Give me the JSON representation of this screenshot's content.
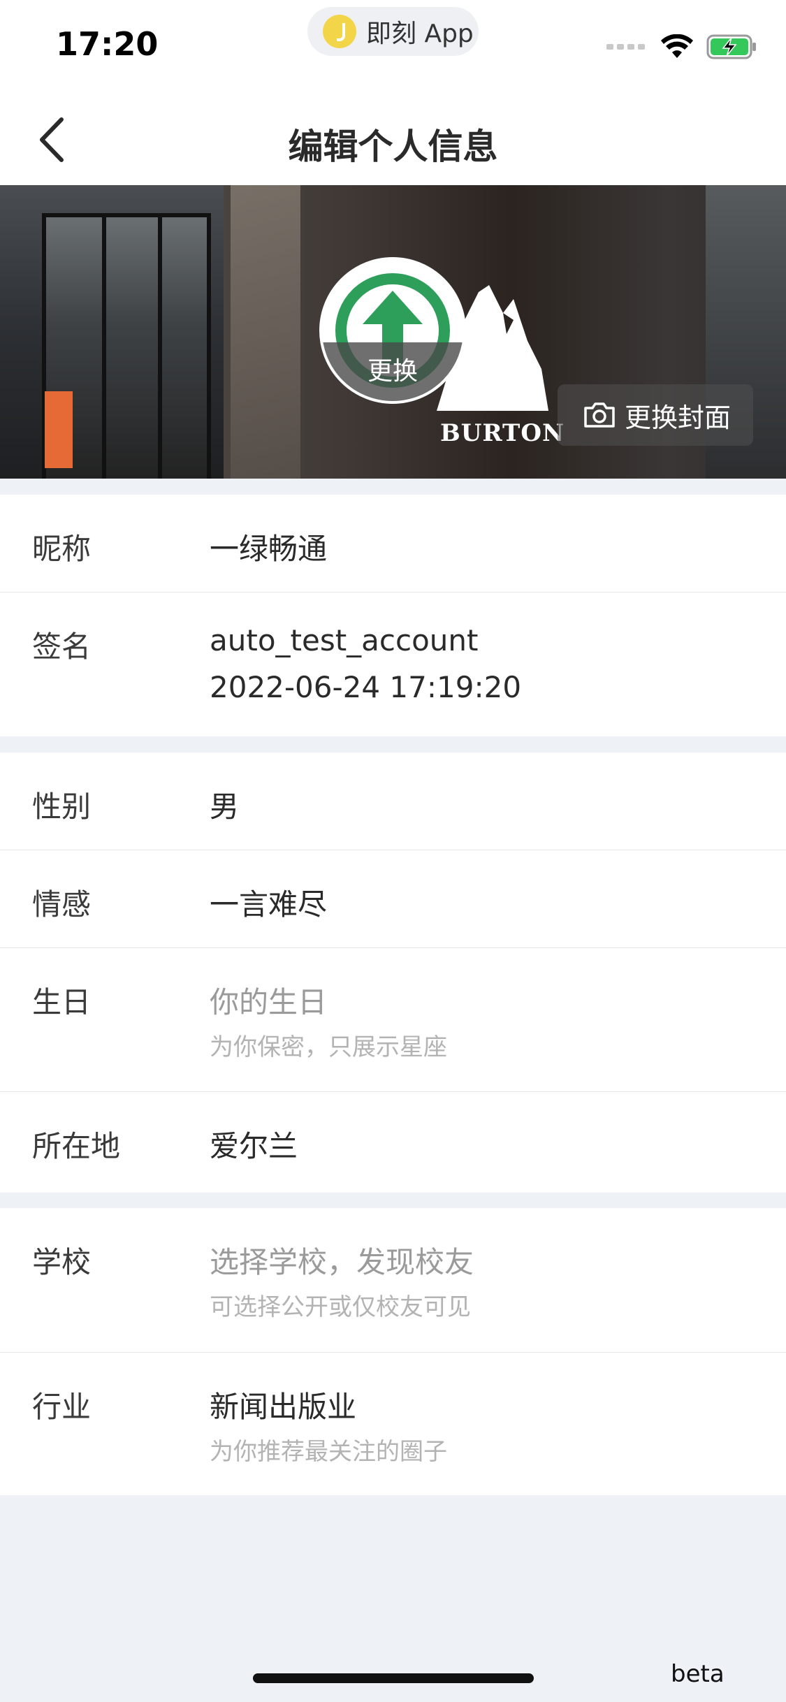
{
  "status_bar": {
    "time": "17:20",
    "app_pill": "即刻 App"
  },
  "nav": {
    "title": "编辑个人信息"
  },
  "cover": {
    "brand": "BURTON",
    "avatar_label": "更换",
    "change_cover_label": "更换封面"
  },
  "profile": {
    "nickname": {
      "label": "昵称",
      "value": "一绿畅通"
    },
    "signature": {
      "label": "签名",
      "line1": "auto_test_account",
      "line2": "2022-06-24 17:19:20"
    },
    "gender": {
      "label": "性别",
      "value": "男"
    },
    "relationship": {
      "label": "情感",
      "value": "一言难尽"
    },
    "birthday": {
      "label": "生日",
      "placeholder": "你的生日",
      "hint": "为你保密，只展示星座"
    },
    "location": {
      "label": "所在地",
      "value": "爱尔兰"
    },
    "school": {
      "label": "学校",
      "placeholder": "选择学校，发现校友",
      "hint": "可选择公开或仅校友可见"
    },
    "industry": {
      "label": "行业",
      "value": "新闻出版业",
      "hint": "为你推荐最关注的圈子"
    }
  },
  "footer": {
    "beta": "beta"
  },
  "colors": {
    "page_background": "#eef1f5",
    "avatar_logo_green": "#2e9e5b",
    "battery_green": "#34c759"
  }
}
